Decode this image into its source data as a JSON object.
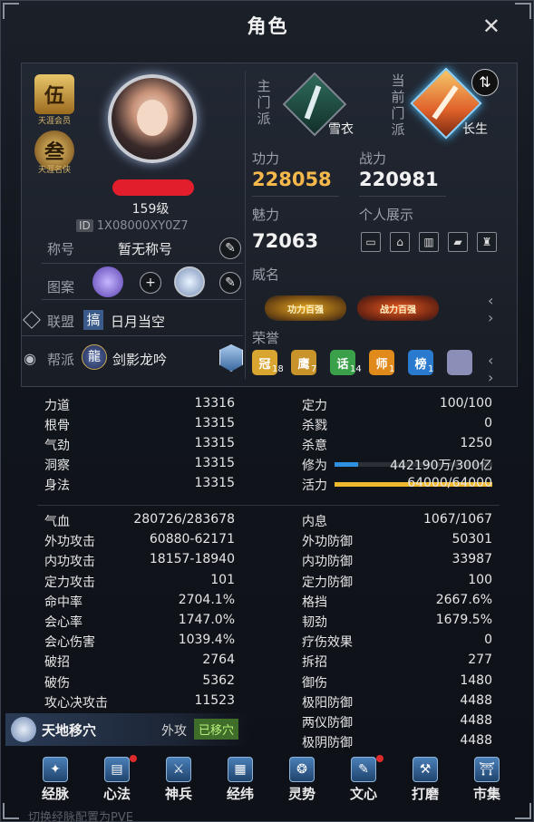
{
  "window": {
    "title": "角色",
    "close_glyph": "✕"
  },
  "profile": {
    "badge1": {
      "char": "伍",
      "caption": "天涯会员"
    },
    "badge2": {
      "char": "叁",
      "caption": "天涯名侠"
    },
    "level": "159级",
    "id_tag": "ID",
    "id": "1X08000XY0Z7"
  },
  "info": {
    "title_label": "称号",
    "title_value": "暂无称号",
    "pattern_label": "图案",
    "plus": "+",
    "alliance_label": "联盟",
    "alliance_char": "搞",
    "alliance_value": "日月当空",
    "guild_label": "帮派",
    "guild_char": "龍",
    "guild_value": "剑影龙吟"
  },
  "sects": {
    "main_label": "主门派",
    "main_name": "雪衣",
    "current_label": "当前门派",
    "current_name": "长生",
    "swap_glyph": "⇅"
  },
  "power": {
    "gongli_label": "功力",
    "gongli": "228058",
    "zhanli_label": "战力",
    "zhanli": "220981",
    "meili_label": "魅力",
    "meili": "72063",
    "show_label": "个人展示",
    "fame_label": "威名",
    "fame1": "功力百强",
    "fame2": "战力百强",
    "honor_label": "荣誉",
    "honors": [
      {
        "count": "18",
        "color": "#d8a531",
        "char": "冠"
      },
      {
        "count": "7",
        "color": "#c8932b",
        "char": "鹰"
      },
      {
        "count": "14",
        "color": "#3aa14a",
        "char": "话"
      },
      {
        "count": "1",
        "color": "#e08a1c",
        "char": "师"
      },
      {
        "count": "1",
        "color": "#2a7bd0",
        "char": "榜"
      },
      {
        "count": "",
        "color": "#8b8fb8",
        "char": ""
      }
    ],
    "arrows": "‹ ›"
  },
  "stats_top_left": [
    {
      "label": "力道",
      "value": "13316"
    },
    {
      "label": "根骨",
      "value": "13315"
    },
    {
      "label": "气劲",
      "value": "13315"
    },
    {
      "label": "洞察",
      "value": "13315"
    },
    {
      "label": "身法",
      "value": "13315"
    }
  ],
  "stats_top_right": [
    {
      "label": "定力",
      "value": "100/100"
    },
    {
      "label": "杀戮",
      "value": "0"
    },
    {
      "label": "杀意",
      "value": "1250"
    },
    {
      "label": "修为",
      "value": "442190万/300亿",
      "bar": 0.15,
      "bar_color": "#2f8fe0"
    },
    {
      "label": "活力",
      "value": "64000/64000",
      "bar": 1.0,
      "bar_color": "#f0b82c"
    }
  ],
  "stats_left": [
    {
      "label": "气血",
      "value": "280726/283678"
    },
    {
      "label": "外功攻击",
      "value": "60880-62171"
    },
    {
      "label": "内功攻击",
      "value": "18157-18940"
    },
    {
      "label": "定力攻击",
      "value": "101"
    },
    {
      "label": "命中率",
      "value": "2704.1%"
    },
    {
      "label": "会心率",
      "value": "1747.0%"
    },
    {
      "label": "会心伤害",
      "value": "1039.4%"
    },
    {
      "label": "破招",
      "value": "2764"
    },
    {
      "label": "破伤",
      "value": "5362"
    },
    {
      "label": "攻心决攻击",
      "value": "11523"
    }
  ],
  "stats_right": [
    {
      "label": "内息",
      "value": "1067/1067"
    },
    {
      "label": "外功防御",
      "value": "50301"
    },
    {
      "label": "内功防御",
      "value": "33987"
    },
    {
      "label": "定力防御",
      "value": "100"
    },
    {
      "label": "格挡",
      "value": "2667.6%"
    },
    {
      "label": "韧劲",
      "value": "1679.5%"
    },
    {
      "label": "疗伤效果",
      "value": "0"
    },
    {
      "label": "拆招",
      "value": "277"
    },
    {
      "label": "御伤",
      "value": "1480"
    },
    {
      "label": "极阳防御",
      "value": "4488"
    },
    {
      "label": "两仪防御",
      "value": "4488"
    },
    {
      "label": "极阴防御",
      "value": "4488"
    }
  ],
  "skill": {
    "name": "天地移穴",
    "type": "外攻",
    "badge": "已移穴"
  },
  "tabs": [
    {
      "label": "经脉",
      "icon": "✦",
      "dot": false
    },
    {
      "label": "心法",
      "icon": "▤",
      "dot": true
    },
    {
      "label": "神兵",
      "icon": "⚔",
      "dot": false
    },
    {
      "label": "经纬",
      "icon": "▦",
      "dot": false
    },
    {
      "label": "灵势",
      "icon": "❂",
      "dot": false
    },
    {
      "label": "文心",
      "icon": "✎",
      "dot": true
    },
    {
      "label": "打磨",
      "icon": "⚒",
      "dot": false
    },
    {
      "label": "市集",
      "icon": "⛩",
      "dot": false
    }
  ],
  "background_text": "切换经脉配置为PVE"
}
